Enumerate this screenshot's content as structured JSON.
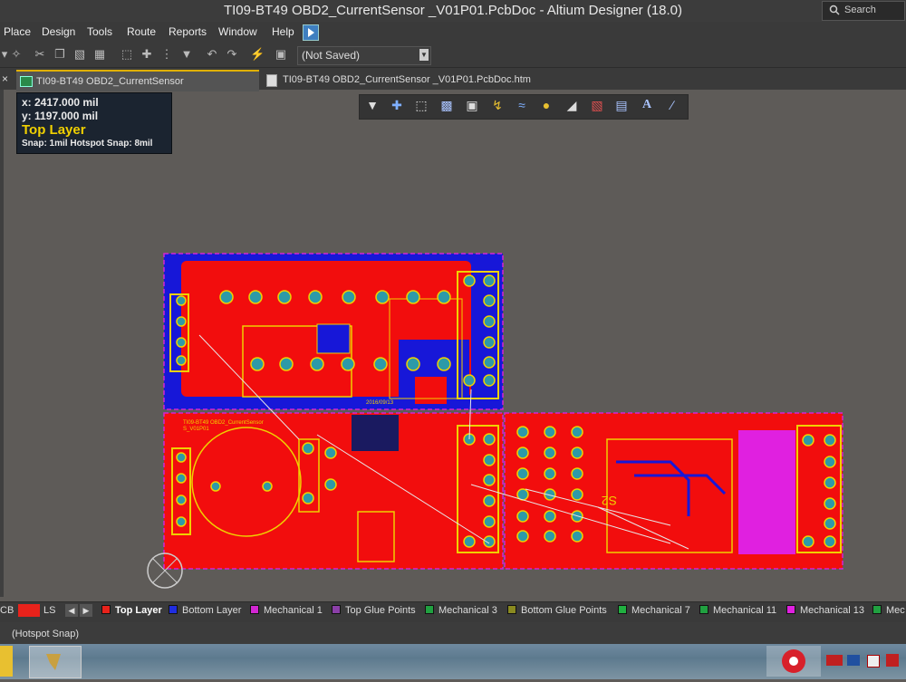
{
  "window": {
    "title": "TI09-BT49 OBD2_CurrentSensor _V01P01.PcbDoc - Altium Designer (18.0)",
    "search_placeholder": "Search"
  },
  "menu": [
    "Place",
    "Design",
    "Tools",
    "Route",
    "Reports",
    "Window",
    "Help"
  ],
  "toolbar": {
    "state_value": "(Not Saved)"
  },
  "tabs": [
    {
      "label": "TI09-BT49 OBD2_CurrentSensor _V01P01.PcbDoc",
      "active": true
    },
    {
      "label": "TI09-BT49 OBD2_CurrentSensor _V01P01.PcbDoc.htm",
      "active": false
    }
  ],
  "hud": {
    "x": "x:  2417.000 mil",
    "y": "y:  1197.000 mil",
    "layer": "Top Layer",
    "snap": "Snap: 1mil Hotspot Snap: 8mil"
  },
  "active_bar_icons": [
    "filter-icon",
    "add-icon",
    "select-rect-icon",
    "align-icon",
    "component-icon",
    "route-icon",
    "diff-pair-icon",
    "pad-icon",
    "polygon-icon",
    "keepout-icon",
    "dimension-icon",
    "text-icon",
    "line-icon"
  ],
  "board_silk": {
    "date": "2016/09/13",
    "label_main": "TI09-BT49 OBD2_CurrentSensor",
    "label_rev": "S_V01P01",
    "designator": "S2"
  },
  "layers": {
    "prefix": "CB",
    "ls": "LS",
    "items": [
      {
        "label": "Top Layer",
        "color": "#e8221b",
        "active": true
      },
      {
        "label": "Bottom Layer",
        "color": "#1f2ddf"
      },
      {
        "label": "Mechanical 1",
        "color": "#d226d2"
      },
      {
        "label": "Top Glue Points",
        "color": "#8b3fa8"
      },
      {
        "label": "Mechanical 3",
        "color": "#20a040"
      },
      {
        "label": "Bottom Glue Points",
        "color": "#8a8a20"
      },
      {
        "label": "Mechanical 7",
        "color": "#20b040"
      },
      {
        "label": "Mechanical 11",
        "color": "#20a040"
      },
      {
        "label": "Mechanical 13",
        "color": "#e020e0"
      },
      {
        "label": "Mec",
        "color": "#20a040"
      }
    ]
  },
  "status": {
    "text": "(Hotspot Snap)"
  },
  "colors": {
    "copper_top": "#f20d0d",
    "copper_bottom": "#1717d8",
    "pad": "#2d9aa8",
    "silk": "#f0d000",
    "outline": "#d226d2"
  }
}
